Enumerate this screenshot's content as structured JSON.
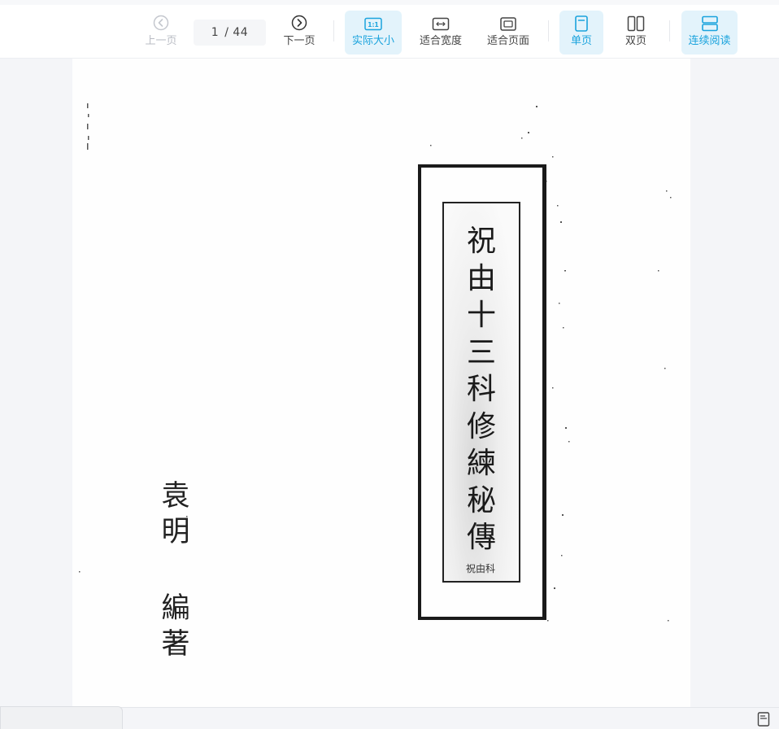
{
  "toolbar": {
    "prev_label": "上一页",
    "next_label": "下一页",
    "current_page": "1",
    "total_pages": "/ 44",
    "actual_size_label": "实际大小",
    "actual_size_icon_text": "1:1",
    "fit_width_label": "适合宽度",
    "fit_page_label": "适合页面",
    "single_page_label": "单页",
    "double_page_label": "双页",
    "continuous_label": "连续阅读"
  },
  "document": {
    "title": "祝由十三科修練秘傳",
    "title_small": "祝由科",
    "author_name": "袁明",
    "author_role": "編著"
  },
  "colors": {
    "accent": "#1aa3dd",
    "active_bg": "#e3f3fb",
    "disabled": "#b9bcc4"
  }
}
